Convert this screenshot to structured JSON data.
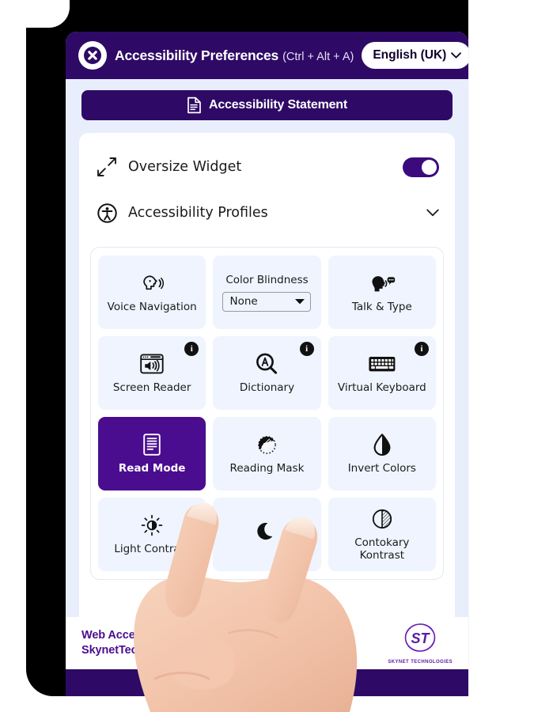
{
  "header": {
    "close_icon": "close-x-icon",
    "title": "Accessibility Preferences",
    "shortcut": "(Ctrl + Alt + A)",
    "language": "English (UK)",
    "language_caret_icon": "chevron-down-icon"
  },
  "statement": {
    "label": "Accessibility Statement",
    "icon": "document-icon"
  },
  "options": [
    {
      "key": "oversize_widget",
      "label": "Oversize Widget",
      "icon": "expand-arrows-icon",
      "control": "toggle",
      "value": "on"
    },
    {
      "key": "accessibility_profiles",
      "label": "Accessibility Profiles",
      "icon": "accessibility-person-icon",
      "control": "accordion",
      "value": "collapsed"
    }
  ],
  "tiles": [
    {
      "key": "voice_navigation",
      "label": "Voice Navigation",
      "icon": "head-speaking-icon",
      "active": false,
      "badge": false
    },
    {
      "key": "color_blindness",
      "label": "Color Blindness",
      "icon": "select-control",
      "active": false,
      "badge": false,
      "select": {
        "value": "None",
        "caret_icon": "caret-down-icon"
      }
    },
    {
      "key": "talk_and_type",
      "label": "Talk & Type",
      "icon": "head-chat-icon",
      "active": false,
      "badge": false
    },
    {
      "key": "screen_reader",
      "label": "Screen Reader",
      "icon": "screen-speaker-icon",
      "active": false,
      "badge": true,
      "badge_label": "i"
    },
    {
      "key": "dictionary",
      "label": "Dictionary",
      "icon": "magnifier-a-icon",
      "active": false,
      "badge": true,
      "badge_label": "i"
    },
    {
      "key": "virtual_keyboard",
      "label": "Virtual Keyboard",
      "icon": "keyboard-icon",
      "active": false,
      "badge": true,
      "badge_label": "i"
    },
    {
      "key": "read_mode",
      "label": "Read Mode",
      "icon": "reading-page-icon",
      "active": true,
      "badge": false
    },
    {
      "key": "reading_mask",
      "label": "Reading Mask",
      "icon": "reading-mask-icon",
      "active": false,
      "badge": false
    },
    {
      "key": "invert_colors",
      "label": "Invert Colors",
      "icon": "droplet-contrast-icon",
      "active": false,
      "badge": false
    },
    {
      "key": "light_contrast",
      "label": "Light Contrast",
      "icon": "sun-contrast-icon",
      "active": false,
      "badge": false
    },
    {
      "key": "dark_contrast",
      "label": "",
      "icon": "moon-icon",
      "active": false,
      "badge": false
    },
    {
      "key": "contokary_kontrast",
      "label": "Contokary\nKontrast",
      "icon": "circle-hatch-icon",
      "active": false,
      "badge": false
    }
  ],
  "footer": {
    "line1": "Web Accessibility S",
    "line2": "SkynetTechnologi",
    "logo_mark": "ST",
    "logo_caption": "SKYNET TECHNOLOGIES"
  },
  "colors": {
    "header_purple": "#2e0a66",
    "active_purple": "#4a0d8f",
    "tile_bg": "#eff4fe",
    "panel_bg": "#e8eefb",
    "card_bg": "#ffffff",
    "bezel": "#000000"
  },
  "cursor": {
    "type": "hand-touch-pointer",
    "target": "read_mode"
  }
}
